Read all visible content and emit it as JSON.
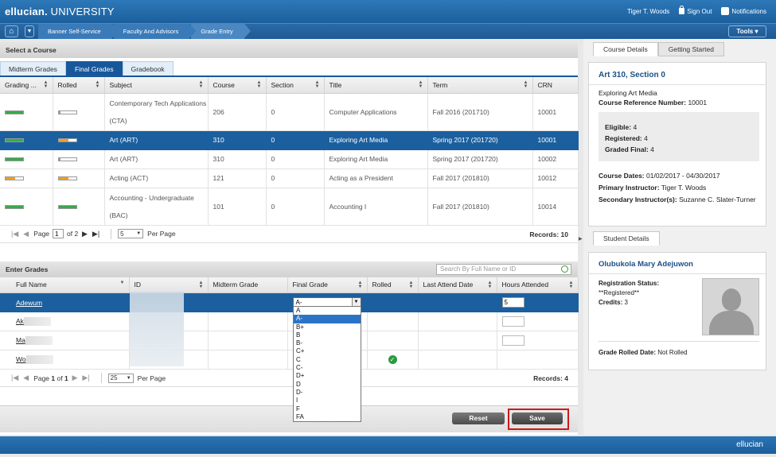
{
  "header": {
    "brand_main": "ellucian.",
    "brand_sub": "UNIVERSITY",
    "user": "Tiger T. Woods",
    "sign_out": "Sign Out",
    "notifications": "Notifications"
  },
  "nav": {
    "home_icon": "home-icon",
    "breadcrumbs": [
      "Banner Self-Service",
      "Faculty And Advisors",
      "Grade Entry"
    ],
    "tools": "Tools ▾"
  },
  "course_select": {
    "title": "Select a Course",
    "tabs": [
      "Midterm Grades",
      "Final Grades",
      "Gradebook"
    ],
    "active_tab": "Final Grades",
    "columns": [
      "Grading ...",
      "Rolled",
      "Subject",
      "Course",
      "Section",
      "Title",
      "Term",
      "CRN"
    ],
    "rows": [
      {
        "grading": "green",
        "rolled": "low",
        "subject": "Contemporary Tech Applications (CTA)",
        "course": "206",
        "section": "0",
        "title": "Computer Applications",
        "term": "Fall 2016 (201710)",
        "crn": "10001"
      },
      {
        "grading": "green",
        "rolled": "orange",
        "subject": "Art (ART)",
        "course": "310",
        "section": "0",
        "title": "Exploring Art Media",
        "term": "Spring 2017 (201720)",
        "crn": "10001",
        "selected": true
      },
      {
        "grading": "green",
        "rolled": "low",
        "subject": "Art (ART)",
        "course": "310",
        "section": "0",
        "title": "Exploring Art Media",
        "term": "Spring 2017 (201720)",
        "crn": "10002"
      },
      {
        "grading": "orange",
        "rolled": "orange",
        "subject": "Acting (ACT)",
        "course": "121",
        "section": "0",
        "title": "Acting as a President",
        "term": "Fall 2017 (201810)",
        "crn": "10012"
      },
      {
        "grading": "green",
        "rolled": "green",
        "subject": "Accounting - Undergraduate (BAC)",
        "course": "101",
        "section": "0",
        "title": "Accounting I",
        "term": "Fall 2017 (201810)",
        "crn": "10014"
      }
    ],
    "pager": {
      "page_label": "Page",
      "page": "1",
      "of_label": "of",
      "total": "2",
      "per_page": "5",
      "per_page_label": "Per Page",
      "records": "Records: 10"
    }
  },
  "enter_grades": {
    "title": "Enter Grades",
    "search_placeholder": "Search By Full Name or ID",
    "columns": [
      "Full Name",
      "ID",
      "Midterm Grade",
      "Final Grade",
      "Rolled",
      "Last Attend Date",
      "Hours Attended"
    ],
    "rows": [
      {
        "name": "Adewum",
        "final_grade": "A-",
        "hours": "5",
        "selected": true
      },
      {
        "name": "Ak",
        "final_grade": "",
        "hours": ""
      },
      {
        "name": "Ma",
        "final_grade": "",
        "hours": ""
      },
      {
        "name": "Wo",
        "final_grade": "",
        "hours": "",
        "rolled_check": true
      }
    ],
    "grade_options": [
      "A",
      "A-",
      "B+",
      "B",
      "B-",
      "C+",
      "C",
      "C-",
      "D+",
      "D",
      "D-",
      "I",
      "F",
      "FA"
    ],
    "highlighted_option": "A-",
    "pager": {
      "page_label": "Page",
      "page": "1",
      "of_label": "of",
      "total": "1",
      "per_page": "25",
      "per_page_label": "Per Page",
      "records": "Records: 4"
    },
    "reset": "Reset",
    "save": "Save"
  },
  "course_details": {
    "tabs": [
      "Course Details",
      "Getting Started"
    ],
    "title": "Art 310, Section 0",
    "subtitle": "Exploring Art Media",
    "ref_label": "Course Reference Number:",
    "ref_value": "10001",
    "eligible_label": "Eligible:",
    "eligible_value": "4",
    "registered_label": "Registered:",
    "registered_value": "4",
    "graded_label": "Graded Final:",
    "graded_value": "4",
    "dates_label": "Course Dates:",
    "dates_value": "01/02/2017 - 04/30/2017",
    "primary_label": "Primary Instructor:",
    "primary_value": "Tiger T. Woods",
    "secondary_label": "Secondary Instructor(s):",
    "secondary_value": "Suzanne C. Slater-Turner"
  },
  "student_details": {
    "tab": "Student Details",
    "name": "Olubukola Mary Adejuwon",
    "status_label": "Registration Status:",
    "status_value": "**Registered**",
    "credits_label": "Credits:",
    "credits_value": "3",
    "rolled_label": "Grade Rolled Date:",
    "rolled_value": "Not Rolled"
  },
  "footer": {
    "logo": "ellucian"
  }
}
